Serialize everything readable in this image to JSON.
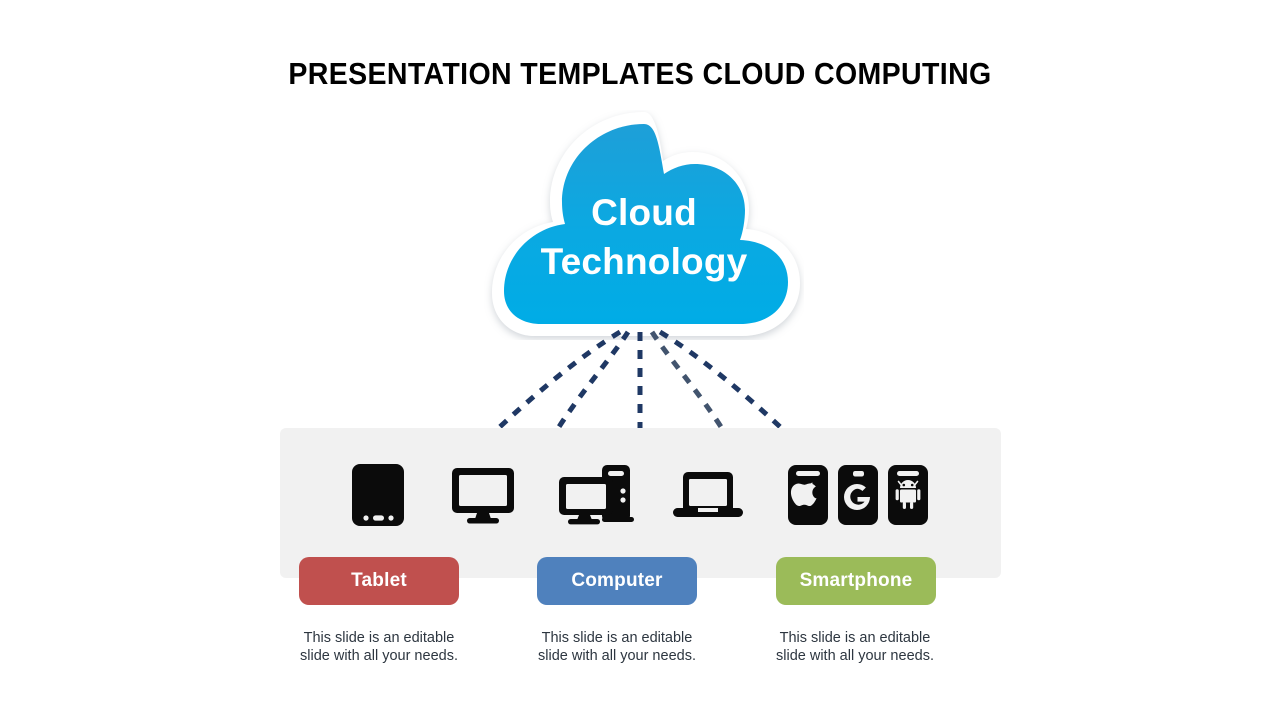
{
  "slide": {
    "title": "PRESENTATION TEMPLATES CLOUD COMPUTING",
    "background_color": "#ffffff"
  },
  "cloud": {
    "line1": "Cloud",
    "line2": "Technology",
    "gradient_top": "#1e9fd8",
    "gradient_bottom": "#00ace6",
    "outline_color": "#ffffff"
  },
  "connectors": {
    "count": 5,
    "style": "dashed",
    "color": "#1f3864"
  },
  "band": {
    "color": "#f1f1f1"
  },
  "devices": [
    {
      "name": "tablet",
      "icon": "tablet-icon"
    },
    {
      "name": "monitor",
      "icon": "monitor-icon"
    },
    {
      "name": "desktop-tower",
      "icon": "desktop-tower-icon"
    },
    {
      "name": "laptop",
      "icon": "laptop-icon"
    },
    {
      "name": "phone-apple",
      "icon": "apple-phone-icon"
    },
    {
      "name": "phone-google",
      "icon": "google-phone-icon"
    },
    {
      "name": "phone-android",
      "icon": "android-phone-icon"
    }
  ],
  "categories": [
    {
      "label": "Tablet",
      "color": "#c0504e",
      "caption_line1": "This slide is an editable",
      "caption_line2": "slide with all your needs."
    },
    {
      "label": "Computer",
      "color": "#4f81bd",
      "caption_line1": "This slide is an editable",
      "caption_line2": "slide with all your needs."
    },
    {
      "label": "Smartphone",
      "color": "#9bbb59",
      "caption_line1": "This slide is an editable",
      "caption_line2": "slide with all your needs."
    }
  ]
}
